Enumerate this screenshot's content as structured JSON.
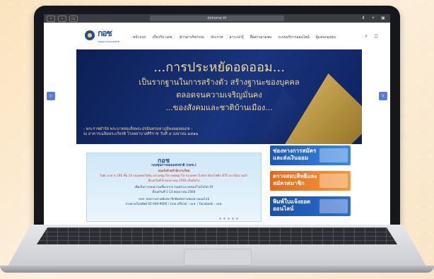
{
  "browser": {
    "url": "dohome.th",
    "bookmark_icon": "sidebar-icon"
  },
  "header": {
    "logo_text": "กอช",
    "logo_caption": "กองทุนการออมแห่งชาติ",
    "menu": [
      "หน้าแรก",
      "เกี่ยวกับ กอช.",
      "ข่าวสารกิจกรรม",
      "ประกาศ",
      "สาระน่ารู้",
      "สื่อสารมวลชน",
      "ระบบบริการออนไลน์",
      "ผู้แทนกองทุน"
    ],
    "search_icon": "search-icon",
    "mobile_icon": "mobile-icon"
  },
  "banner": {
    "line1": "...การประหยัดอดออม...",
    "line2": "เป็นรากฐานในการสร้างตัว สร้างฐานะของบุคคล",
    "line3": "ตลอดจนความเจริญมั่นคง",
    "line4": "...ของสังคมและชาติบ้านเมือง...",
    "quote1": "- พระราชดำรัส พระบาทสมเด็จพระปรมินทรมหาภูมิพลอดุลยเดช -",
    "quote2": "ณ อาคารเฉลิมพระเกียรติ โรงพยาบาลศิริราช วันที่ ๔ เมษายน ๒๕๑๒"
  },
  "notice": {
    "title": "กอช",
    "subtitle": "กองทุนการออมแห่งชาติ (กอช.)",
    "line1": "ขอแจ้งย้ายสำนักงานใหม่",
    "line2": "ไปยัง อาคาร 185 ชั้น 14 ถนนพหลโยธิน แขวงพญาไท เขตพญาไท กรุงเทพฯ ใกล้สถานีรถไฟฟ้า BTS สถานีสนามเป้า",
    "line3": "ตั้งแต่วันที่ 8 พฤษภาคม 2564 เป็นต้นไป",
    "line4": "เพื่อเป็นการลดความเสี่ยงจากการแพร่ระบาดของโรคโควิด-19",
    "line5": "ตั้งแต่วันที่ 1-13 พฤษภาคม 2564",
    "line6": "กอช. ขอความร่วมมือสมาชิกติดต่อผ่านช่องทางออนไลน์",
    "line7": "สายด่วนโทรศัพท์ 02-049-9000 / Line official : กอช. / Facebook : กอช."
  },
  "side_buttons": [
    {
      "label1": "ช่องทางการสมัคร",
      "label2": "และส่งเงินออม"
    },
    {
      "label1": "ตรวจสอบสิทธิและ",
      "label2": "สมัครสมาชิก"
    },
    {
      "label1": "พิมพ์ใบแจ้งยอด",
      "label2": "ออนไลน์"
    }
  ],
  "colors": {
    "brand": "#1f4fa6",
    "gold": "#f3d98a",
    "orange": "#e46a1c"
  }
}
